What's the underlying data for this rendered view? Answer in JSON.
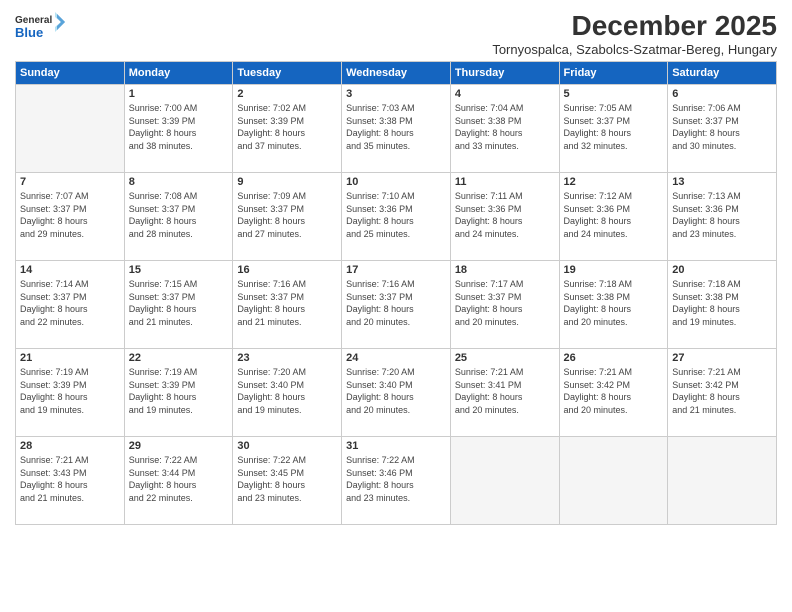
{
  "header": {
    "logo_line1": "General",
    "logo_line2": "Blue",
    "month": "December 2025",
    "location": "Tornyospalca, Szabolcs-Szatmar-Bereg, Hungary"
  },
  "days_of_week": [
    "Sunday",
    "Monday",
    "Tuesday",
    "Wednesday",
    "Thursday",
    "Friday",
    "Saturday"
  ],
  "weeks": [
    [
      {
        "day": "",
        "info": ""
      },
      {
        "day": "1",
        "info": "Sunrise: 7:00 AM\nSunset: 3:39 PM\nDaylight: 8 hours\nand 38 minutes."
      },
      {
        "day": "2",
        "info": "Sunrise: 7:02 AM\nSunset: 3:39 PM\nDaylight: 8 hours\nand 37 minutes."
      },
      {
        "day": "3",
        "info": "Sunrise: 7:03 AM\nSunset: 3:38 PM\nDaylight: 8 hours\nand 35 minutes."
      },
      {
        "day": "4",
        "info": "Sunrise: 7:04 AM\nSunset: 3:38 PM\nDaylight: 8 hours\nand 33 minutes."
      },
      {
        "day": "5",
        "info": "Sunrise: 7:05 AM\nSunset: 3:37 PM\nDaylight: 8 hours\nand 32 minutes."
      },
      {
        "day": "6",
        "info": "Sunrise: 7:06 AM\nSunset: 3:37 PM\nDaylight: 8 hours\nand 30 minutes."
      }
    ],
    [
      {
        "day": "7",
        "info": "Sunrise: 7:07 AM\nSunset: 3:37 PM\nDaylight: 8 hours\nand 29 minutes."
      },
      {
        "day": "8",
        "info": "Sunrise: 7:08 AM\nSunset: 3:37 PM\nDaylight: 8 hours\nand 28 minutes."
      },
      {
        "day": "9",
        "info": "Sunrise: 7:09 AM\nSunset: 3:37 PM\nDaylight: 8 hours\nand 27 minutes."
      },
      {
        "day": "10",
        "info": "Sunrise: 7:10 AM\nSunset: 3:36 PM\nDaylight: 8 hours\nand 25 minutes."
      },
      {
        "day": "11",
        "info": "Sunrise: 7:11 AM\nSunset: 3:36 PM\nDaylight: 8 hours\nand 24 minutes."
      },
      {
        "day": "12",
        "info": "Sunrise: 7:12 AM\nSunset: 3:36 PM\nDaylight: 8 hours\nand 24 minutes."
      },
      {
        "day": "13",
        "info": "Sunrise: 7:13 AM\nSunset: 3:36 PM\nDaylight: 8 hours\nand 23 minutes."
      }
    ],
    [
      {
        "day": "14",
        "info": "Sunrise: 7:14 AM\nSunset: 3:37 PM\nDaylight: 8 hours\nand 22 minutes."
      },
      {
        "day": "15",
        "info": "Sunrise: 7:15 AM\nSunset: 3:37 PM\nDaylight: 8 hours\nand 21 minutes."
      },
      {
        "day": "16",
        "info": "Sunrise: 7:16 AM\nSunset: 3:37 PM\nDaylight: 8 hours\nand 21 minutes."
      },
      {
        "day": "17",
        "info": "Sunrise: 7:16 AM\nSunset: 3:37 PM\nDaylight: 8 hours\nand 20 minutes."
      },
      {
        "day": "18",
        "info": "Sunrise: 7:17 AM\nSunset: 3:37 PM\nDaylight: 8 hours\nand 20 minutes."
      },
      {
        "day": "19",
        "info": "Sunrise: 7:18 AM\nSunset: 3:38 PM\nDaylight: 8 hours\nand 20 minutes."
      },
      {
        "day": "20",
        "info": "Sunrise: 7:18 AM\nSunset: 3:38 PM\nDaylight: 8 hours\nand 19 minutes."
      }
    ],
    [
      {
        "day": "21",
        "info": "Sunrise: 7:19 AM\nSunset: 3:39 PM\nDaylight: 8 hours\nand 19 minutes."
      },
      {
        "day": "22",
        "info": "Sunrise: 7:19 AM\nSunset: 3:39 PM\nDaylight: 8 hours\nand 19 minutes."
      },
      {
        "day": "23",
        "info": "Sunrise: 7:20 AM\nSunset: 3:40 PM\nDaylight: 8 hours\nand 19 minutes."
      },
      {
        "day": "24",
        "info": "Sunrise: 7:20 AM\nSunset: 3:40 PM\nDaylight: 8 hours\nand 20 minutes."
      },
      {
        "day": "25",
        "info": "Sunrise: 7:21 AM\nSunset: 3:41 PM\nDaylight: 8 hours\nand 20 minutes."
      },
      {
        "day": "26",
        "info": "Sunrise: 7:21 AM\nSunset: 3:42 PM\nDaylight: 8 hours\nand 20 minutes."
      },
      {
        "day": "27",
        "info": "Sunrise: 7:21 AM\nSunset: 3:42 PM\nDaylight: 8 hours\nand 21 minutes."
      }
    ],
    [
      {
        "day": "28",
        "info": "Sunrise: 7:21 AM\nSunset: 3:43 PM\nDaylight: 8 hours\nand 21 minutes."
      },
      {
        "day": "29",
        "info": "Sunrise: 7:22 AM\nSunset: 3:44 PM\nDaylight: 8 hours\nand 22 minutes."
      },
      {
        "day": "30",
        "info": "Sunrise: 7:22 AM\nSunset: 3:45 PM\nDaylight: 8 hours\nand 23 minutes."
      },
      {
        "day": "31",
        "info": "Sunrise: 7:22 AM\nSunset: 3:46 PM\nDaylight: 8 hours\nand 23 minutes."
      },
      {
        "day": "",
        "info": ""
      },
      {
        "day": "",
        "info": ""
      },
      {
        "day": "",
        "info": ""
      }
    ]
  ]
}
